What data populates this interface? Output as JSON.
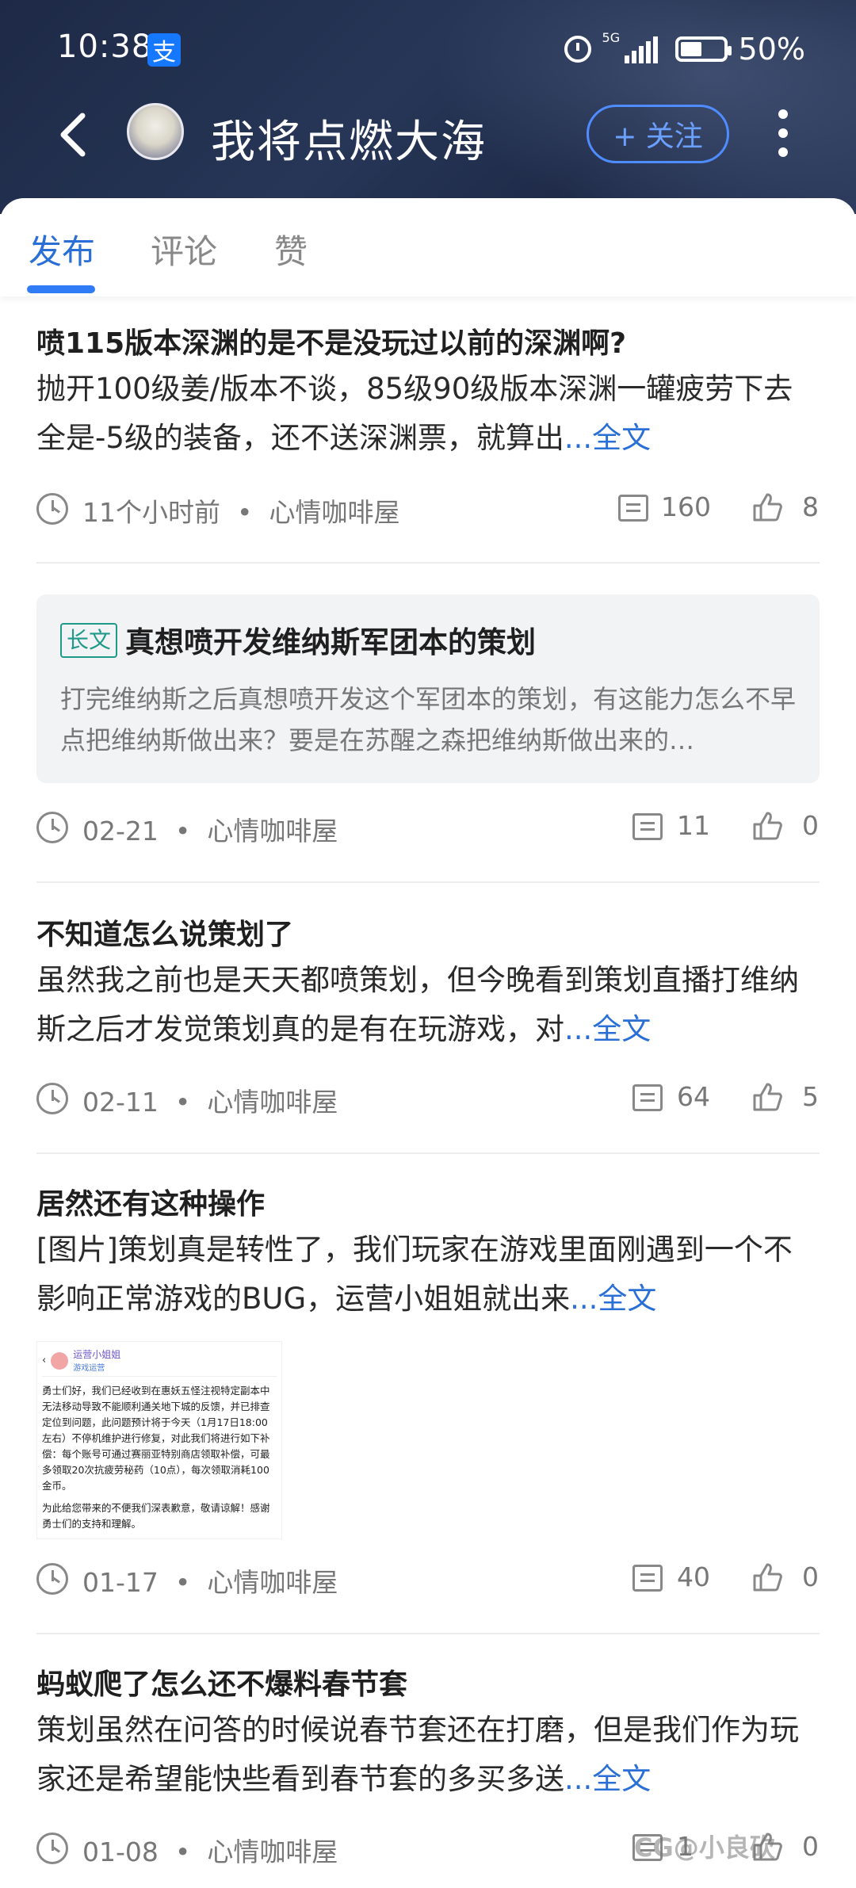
{
  "status_bar": {
    "time": "10:38",
    "alipay_badge": "支",
    "network": "5G",
    "battery": "50%",
    "battery_level": 0.5
  },
  "header": {
    "profile_name": "我将点燃大海",
    "follow_label": "+ 关注"
  },
  "tabs": [
    {
      "label": "发布",
      "active": true
    },
    {
      "label": "评论",
      "active": false
    },
    {
      "label": "赞",
      "active": false
    }
  ],
  "posts": [
    {
      "title": "喷115版本深渊的是不是没玩过以前的深渊啊?",
      "body": "抛开100级姜/版本不谈，85级90级版本深渊一罐疲劳下去全是-5级的装备，还不送深渊票，就算出",
      "more": "...全文",
      "time": "11个小时前",
      "channel": "心情咖啡屋",
      "comments": "160",
      "likes": "8"
    },
    {
      "tag": "长文",
      "title": "真想喷开发维纳斯军团本的策划",
      "excerpt": "打完维纳斯之后真想喷开发这个军团本的策划，有这能力怎么不早点把维纳斯做出来？要是在苏醒之森把维纳斯做出来的…",
      "time": "02-21",
      "channel": "心情咖啡屋",
      "comments": "11",
      "likes": "0"
    },
    {
      "title": "不知道怎么说策划了",
      "body": "虽然我之前也是天天都喷策划，但今晚看到策划直播打维纳斯之后才发觉策划真的是有在玩游戏，对",
      "more": "...全文",
      "time": "02-11",
      "channel": "心情咖啡屋",
      "comments": "64",
      "likes": "5"
    },
    {
      "title": "居然还有这种操作",
      "body": "[图片]策划真是转性了，我们玩家在游戏里面刚遇到一个不影响正常游戏的BUG，运营小姐姐就出来",
      "more": "...全文",
      "image": {
        "name": "运营小姐姐",
        "sub": "游戏运营",
        "text": "勇士们好，我们已经收到在惠妖五怪注视特定副本中无法移动导致不能顺利通关地下城的反馈，并已排查定位到问题，此问题预计将于今天（1月17日18:00左右）不停机维护进行修复，对此我们将进行如下补偿：每个账号可通过赛丽亚特别商店领取补偿，可最多领取20次抗疲劳秘药（10点），每次领取消耗100金币。",
        "foot": "为此给您带来的不便我们深表歉意，敬请谅解！感谢勇士们的支持和理解。"
      },
      "time": "01-17",
      "channel": "心情咖啡屋",
      "comments": "40",
      "likes": "0"
    },
    {
      "title": "蚂蚁爬了怎么还不爆料春节套",
      "body": "策划虽然在问答的时候说春节套还在打磨，但是我们作为玩家还是希望能快些看到春节套的多买多送",
      "more": "...全文",
      "time": "01-08",
      "channel": "心情咖啡屋",
      "comments": "1",
      "likes": "0"
    }
  ],
  "meta_separator": "•",
  "watermark": "CG@小良砍"
}
